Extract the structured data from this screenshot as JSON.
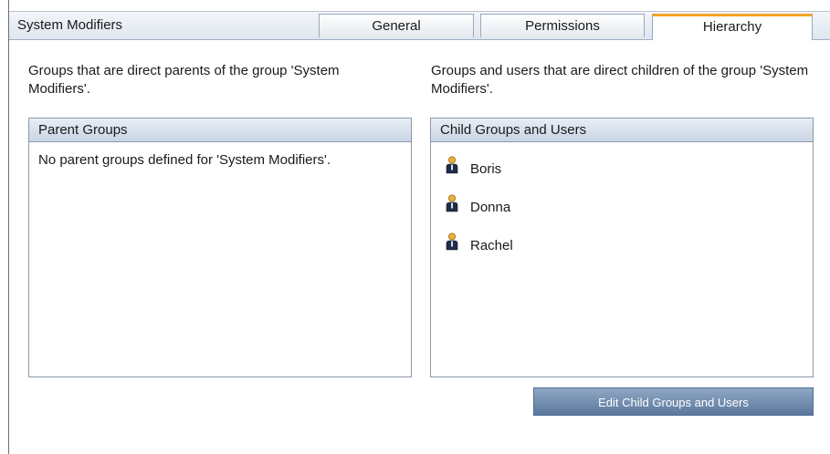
{
  "header": {
    "title": "System Modifiers"
  },
  "tabs": [
    {
      "label": "General"
    },
    {
      "label": "Permissions"
    },
    {
      "label": "Hierarchy",
      "active": true
    }
  ],
  "parents": {
    "description": "Groups that are direct parents of the group 'System Modifiers'.",
    "panel_title": "Parent Groups",
    "empty_text": "No parent groups defined for 'System Modifiers'."
  },
  "children": {
    "description": "Groups and users that are direct children of the group 'System Modifiers'.",
    "panel_title": "Child Groups and Users",
    "items": [
      {
        "name": "Boris",
        "icon": "user-icon"
      },
      {
        "name": "Donna",
        "icon": "user-icon"
      },
      {
        "name": "Rachel",
        "icon": "user-icon"
      }
    ]
  },
  "actions": {
    "edit_label": "Edit Child Groups and Users"
  },
  "colors": {
    "active_tab_accent": "#f4a428",
    "button": "#6f89ad"
  }
}
